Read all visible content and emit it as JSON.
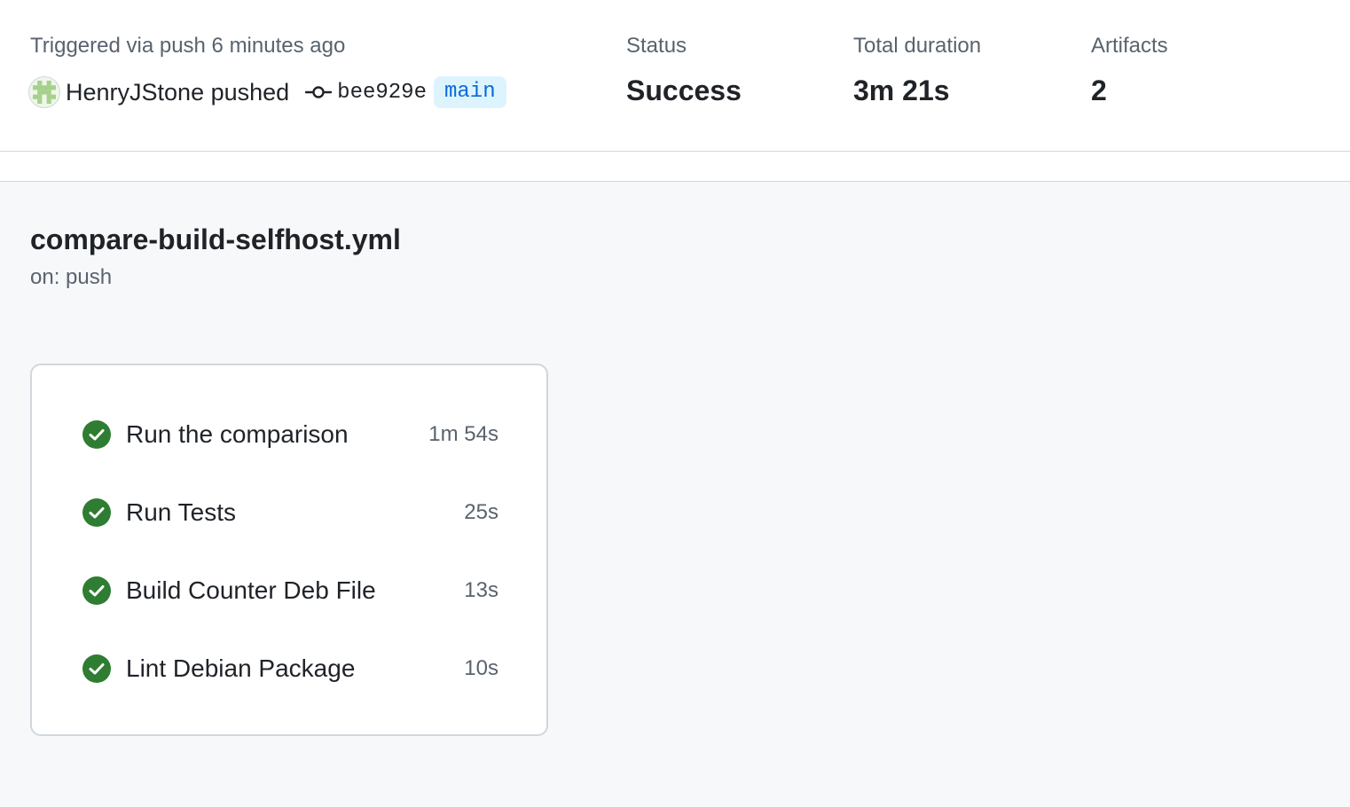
{
  "summary": {
    "trigger_text": "Triggered via push 6 minutes ago",
    "actor": "HenryJStone pushed",
    "commit_sha": "bee929e",
    "branch": "main",
    "status": {
      "label": "Status",
      "value": "Success"
    },
    "duration": {
      "label": "Total duration",
      "value": "3m 21s"
    },
    "artifacts": {
      "label": "Artifacts",
      "value": "2"
    }
  },
  "workflow": {
    "file": "compare-build-selfhost.yml",
    "trigger": "on: push",
    "jobs": [
      {
        "name": "Run the comparison",
        "duration": "1m 54s",
        "status": "success"
      },
      {
        "name": "Run Tests",
        "duration": "25s",
        "status": "success"
      },
      {
        "name": "Build Counter Deb File",
        "duration": "13s",
        "status": "success"
      },
      {
        "name": "Lint Debian Package",
        "duration": "10s",
        "status": "success"
      }
    ]
  },
  "colors": {
    "success": "#1a7f37",
    "branch_text": "#0969da",
    "branch_bg": "#ddf4ff",
    "muted_text": "#59636e"
  },
  "icons": {
    "commit": "git-commit-icon",
    "job_status": "check-circle-fill-icon",
    "avatar": "identicon-avatar"
  }
}
